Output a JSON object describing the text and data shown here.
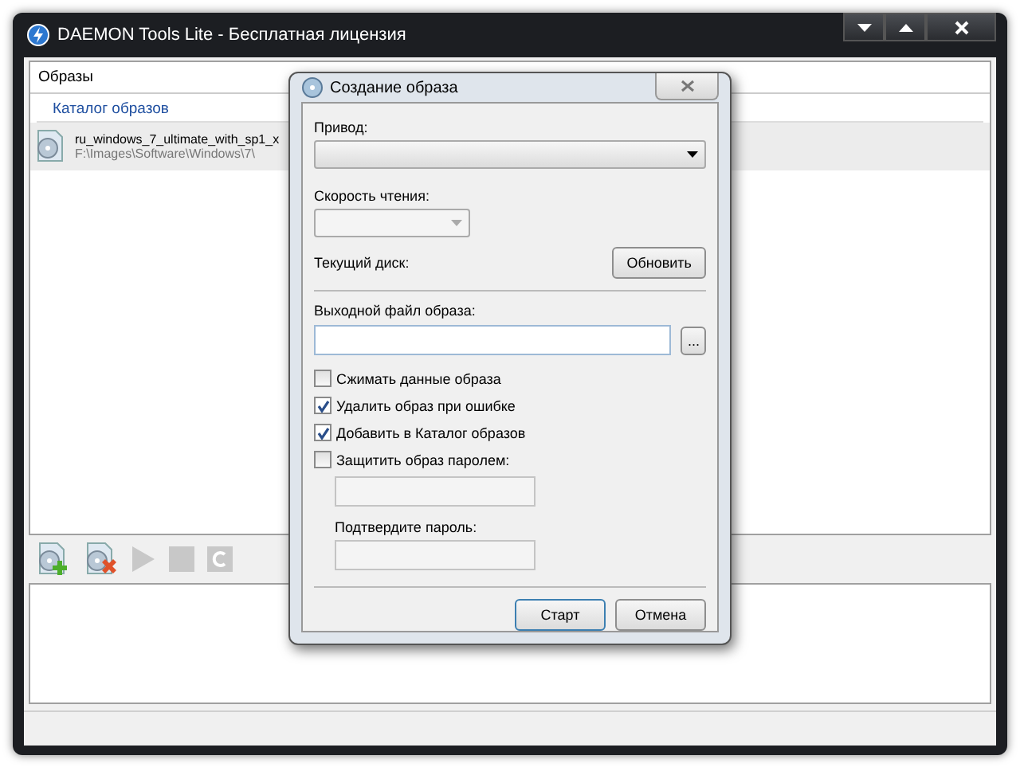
{
  "window": {
    "title": "DAEMON Tools Lite - Бесплатная лицензия"
  },
  "tabs": [
    {
      "label": "Образы",
      "selected": true
    }
  ],
  "catalog": {
    "heading": "Каталог образов",
    "items": [
      {
        "name": "ru_windows_7_ultimate_with_sp1_x",
        "path": "F:\\Images\\Software\\Windows\\7\\",
        "selected": true
      }
    ]
  },
  "toolbar": [
    {
      "kind": "add",
      "disabled": false
    },
    {
      "kind": "remove",
      "disabled": false
    },
    {
      "kind": "play",
      "disabled": true
    },
    {
      "kind": "stop",
      "disabled": true
    },
    {
      "kind": "refresh",
      "disabled": true
    }
  ],
  "dialog": {
    "title": "Создание образа",
    "drive_label": "Привод:",
    "speed_label": "Скорость чтения:",
    "current_disc_label": "Текущий диск:",
    "refresh_button": "Обновить",
    "output_label": "Выходной файл образа:",
    "browse_button": "...",
    "options": [
      {
        "label": "Сжимать данные образа",
        "checked": false
      },
      {
        "label": "Удалить образ при ошибке",
        "checked": true
      },
      {
        "label": "Добавить в Каталог образов",
        "checked": true
      },
      {
        "label": "Защитить образ паролем:",
        "checked": false
      }
    ],
    "confirm_label": "Подтвердите пароль:",
    "buttons": [
      {
        "label": "Старт",
        "default": true
      },
      {
        "label": "Отмена",
        "default": false
      }
    ]
  }
}
